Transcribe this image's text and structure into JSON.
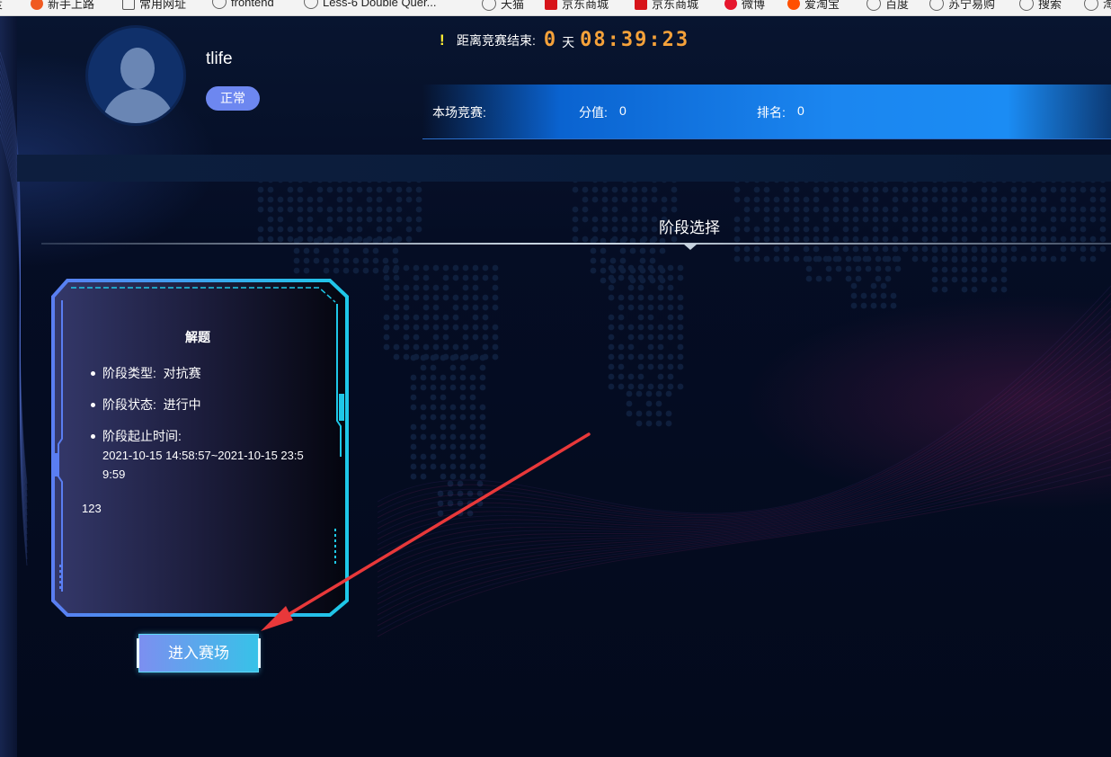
{
  "bookmarks": [
    {
      "label": "度",
      "icon": "globe-icon"
    },
    {
      "label": "新手上路",
      "icon": "firefox-icon"
    },
    {
      "label": "常用网址",
      "icon": "folder-icon"
    },
    {
      "label": "frontend",
      "icon": "globe-icon"
    },
    {
      "label": "Less-6 Double Quer...",
      "icon": "globe-icon"
    },
    {
      "label": "天猫",
      "icon": "globe-icon"
    },
    {
      "label": "京东商城",
      "icon": "jd-icon"
    },
    {
      "label": "京东商城",
      "icon": "jd-icon"
    },
    {
      "label": "微博",
      "icon": "weibo-icon"
    },
    {
      "label": "爱淘宝",
      "icon": "taobao-icon"
    },
    {
      "label": "百度",
      "icon": "globe-icon"
    },
    {
      "label": "苏宁易购",
      "icon": "globe-icon"
    },
    {
      "label": "搜索",
      "icon": "globe-icon"
    },
    {
      "label": "淘",
      "icon": "globe-icon"
    }
  ],
  "user": {
    "name": "tlife",
    "status": "正常"
  },
  "countdown": {
    "label": "距离竞赛结束:",
    "days": "0",
    "day_unit": "天",
    "time": "08:39:23"
  },
  "score": {
    "contest_label": "本场竞赛:",
    "score_label": "分值:",
    "score_value": "0",
    "rank_label": "排名:",
    "rank_value": "0"
  },
  "stage_section_title": "阶段选择",
  "stage_card": {
    "title": "解题",
    "type_label": "阶段类型:",
    "type_value": "对抗赛",
    "status_label": "阶段状态:",
    "status_value": "进行中",
    "time_label": "阶段起止时间:",
    "time_value": "2021-10-15 14:58:57~2021-10-15 23:59:59",
    "description": "123"
  },
  "enter_button_label": "进入赛场",
  "colors": {
    "background": "#030a1c",
    "accent_blue": "#1b86f0",
    "countdown_orange": "#f6a23a",
    "badge": "#6d87f0",
    "card_border": "#1ec8e8",
    "annotation_red": "#e8383a"
  }
}
